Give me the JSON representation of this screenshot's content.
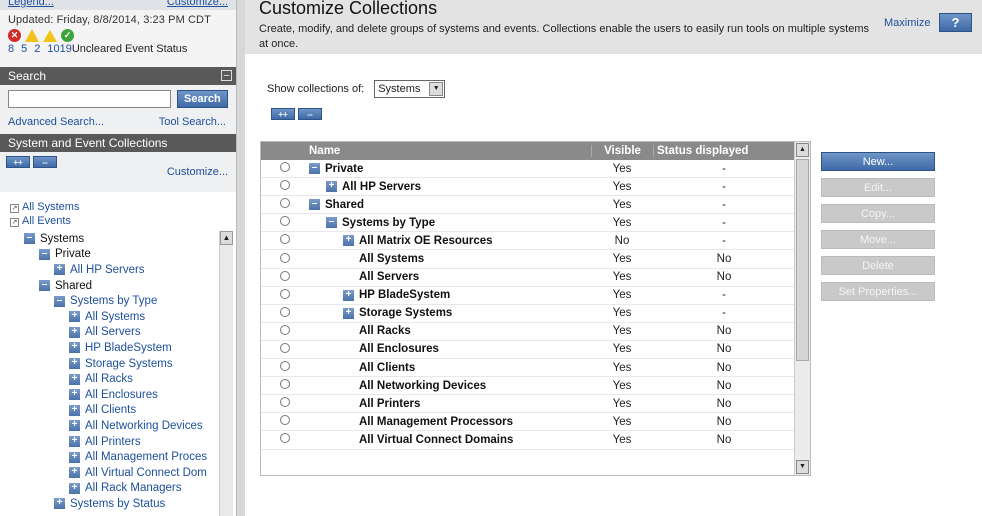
{
  "left": {
    "topbar": {
      "legend": "Legend...",
      "customize": "Customize..."
    },
    "status": {
      "updated": "Updated: Friday, 8/8/2014, 3:23 PM  CDT",
      "counts": [
        "8",
        "5",
        "2",
        "1019"
      ],
      "label": "Uncleared Event Status"
    },
    "search": {
      "header": "Search",
      "button": "Search",
      "value": "",
      "advanced": "Advanced Search...",
      "tool": "Tool Search..."
    },
    "collections": {
      "header": "System and Event Collections",
      "customize": "Customize...",
      "all_systems": "All Systems",
      "all_events": "All Events",
      "tree": [
        {
          "label": "Systems",
          "icon": "minus",
          "indent": 0,
          "style": "blk"
        },
        {
          "label": "Private",
          "icon": "minus",
          "indent": 1,
          "style": "blk"
        },
        {
          "label": "All HP Servers",
          "icon": "plus",
          "indent": 2,
          "style": "lnk"
        },
        {
          "label": "Shared",
          "icon": "minus",
          "indent": 1,
          "style": "blk"
        },
        {
          "label": "Systems by Type",
          "icon": "minus",
          "indent": 2,
          "style": "lnk"
        },
        {
          "label": "All Systems",
          "icon": "plus",
          "indent": 3,
          "style": "lnk"
        },
        {
          "label": "All Servers",
          "icon": "plus",
          "indent": 3,
          "style": "lnk"
        },
        {
          "label": "HP BladeSystem",
          "icon": "plus",
          "indent": 3,
          "style": "lnk"
        },
        {
          "label": "Storage Systems",
          "icon": "plus",
          "indent": 3,
          "style": "lnk"
        },
        {
          "label": "All Racks",
          "icon": "plus",
          "indent": 3,
          "style": "lnk"
        },
        {
          "label": "All Enclosures",
          "icon": "plus",
          "indent": 3,
          "style": "lnk"
        },
        {
          "label": "All Clients",
          "icon": "plus",
          "indent": 3,
          "style": "lnk"
        },
        {
          "label": "All Networking Devices",
          "icon": "plus",
          "indent": 3,
          "style": "lnk"
        },
        {
          "label": "All Printers",
          "icon": "plus",
          "indent": 3,
          "style": "lnk"
        },
        {
          "label": "All Management Proces",
          "icon": "plus",
          "indent": 3,
          "style": "lnk"
        },
        {
          "label": "All Virtual Connect Dom",
          "icon": "plus",
          "indent": 3,
          "style": "lnk"
        },
        {
          "label": "All Rack Managers",
          "icon": "plus",
          "indent": 3,
          "style": "lnk"
        },
        {
          "label": "Systems by Status",
          "icon": "plus",
          "indent": 2,
          "style": "lnk"
        }
      ]
    }
  },
  "main": {
    "title": "Customize Collections",
    "description": "Create, modify, and delete groups of systems and events. Collections enable the users to easily run tools on multiple systems at once.",
    "maximize": "Maximize",
    "help": "?",
    "show_label": "Show collections of:",
    "show_value": "Systems",
    "plus_btn": "++",
    "minus_btn": "--",
    "columns": {
      "name": "Name",
      "visible": "Visible",
      "status": "Status displayed"
    },
    "rows": [
      {
        "name": "Private",
        "icon": "minus",
        "indent": 0,
        "visible": "Yes",
        "status": "-"
      },
      {
        "name": "All HP Servers",
        "icon": "plus",
        "indent": 1,
        "visible": "Yes",
        "status": "-"
      },
      {
        "name": "Shared",
        "icon": "minus",
        "indent": 0,
        "visible": "Yes",
        "status": "-"
      },
      {
        "name": "Systems by Type",
        "icon": "minus",
        "indent": 1,
        "visible": "Yes",
        "status": "-"
      },
      {
        "name": "All Matrix OE Resources",
        "icon": "plus",
        "indent": 2,
        "visible": "No",
        "status": "-"
      },
      {
        "name": "All Systems",
        "icon": "",
        "indent": 2,
        "visible": "Yes",
        "status": "No"
      },
      {
        "name": "All Servers",
        "icon": "",
        "indent": 2,
        "visible": "Yes",
        "status": "No"
      },
      {
        "name": "HP BladeSystem",
        "icon": "plus",
        "indent": 2,
        "visible": "Yes",
        "status": "-"
      },
      {
        "name": "Storage Systems",
        "icon": "plus",
        "indent": 2,
        "visible": "Yes",
        "status": "-"
      },
      {
        "name": "All Racks",
        "icon": "",
        "indent": 2,
        "visible": "Yes",
        "status": "No"
      },
      {
        "name": "All Enclosures",
        "icon": "",
        "indent": 2,
        "visible": "Yes",
        "status": "No"
      },
      {
        "name": "All Clients",
        "icon": "",
        "indent": 2,
        "visible": "Yes",
        "status": "No"
      },
      {
        "name": "All Networking Devices",
        "icon": "",
        "indent": 2,
        "visible": "Yes",
        "status": "No"
      },
      {
        "name": "All Printers",
        "icon": "",
        "indent": 2,
        "visible": "Yes",
        "status": "No"
      },
      {
        "name": "All Management Processors",
        "icon": "",
        "indent": 2,
        "visible": "Yes",
        "status": "No"
      },
      {
        "name": "All Virtual Connect Domains",
        "icon": "",
        "indent": 2,
        "visible": "Yes",
        "status": "No"
      }
    ],
    "buttons": [
      {
        "label": "New...",
        "enabled": true
      },
      {
        "label": "Edit...",
        "enabled": false
      },
      {
        "label": "Copy...",
        "enabled": false
      },
      {
        "label": "Move...",
        "enabled": false
      },
      {
        "label": "Delete",
        "enabled": false
      },
      {
        "label": "Set Properties...",
        "enabled": false
      }
    ]
  }
}
